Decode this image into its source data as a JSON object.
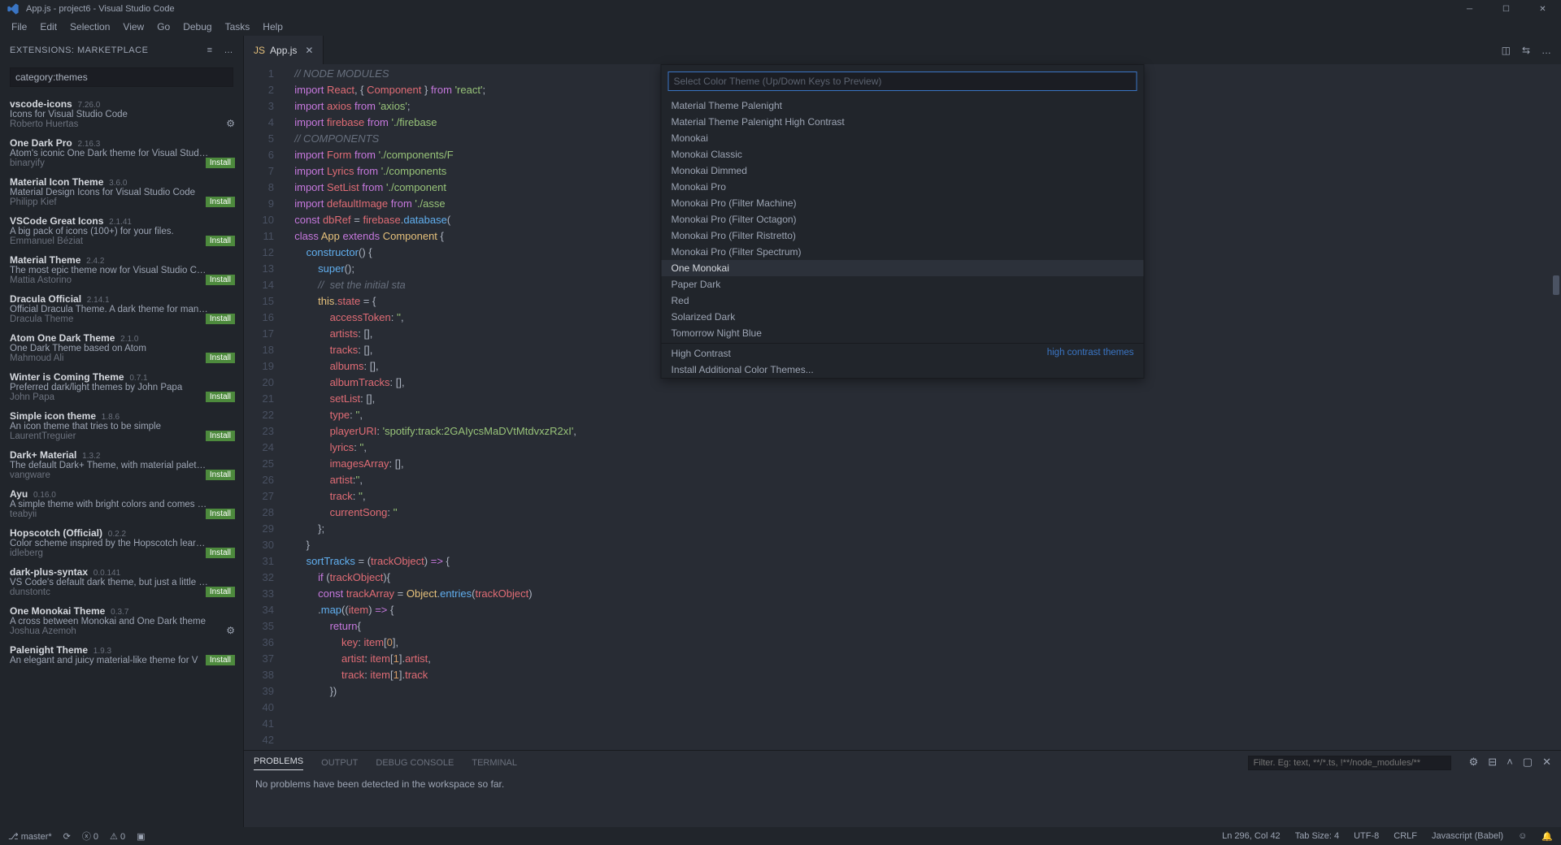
{
  "titlebar": {
    "title": "App.js - project6 - Visual Studio Code"
  },
  "menubar": [
    "File",
    "Edit",
    "Selection",
    "View",
    "Go",
    "Debug",
    "Tasks",
    "Help"
  ],
  "sidebar": {
    "title": "EXTENSIONS: MARKETPLACE",
    "search": "category:themes",
    "items": [
      {
        "name": "vscode-icons",
        "ver": "7.26.0",
        "desc": "Icons for Visual Studio Code",
        "auth": "Roberto Huertas",
        "installed": true
      },
      {
        "name": "One Dark Pro",
        "ver": "2.16.3",
        "desc": "Atom's iconic One Dark theme for Visual Stud…",
        "auth": "binaryify",
        "installed": false
      },
      {
        "name": "Material Icon Theme",
        "ver": "3.6.0",
        "desc": "Material Design Icons for Visual Studio Code",
        "auth": "Philipp Kief",
        "installed": false
      },
      {
        "name": "VSCode Great Icons",
        "ver": "2.1.41",
        "desc": "A big pack of icons (100+) for your files.",
        "auth": "Emmanuel Béziat",
        "installed": false
      },
      {
        "name": "Material Theme",
        "ver": "2.4.2",
        "desc": "The most epic theme now for Visual Studio C…",
        "auth": "Mattia Astorino",
        "installed": false
      },
      {
        "name": "Dracula Official",
        "ver": "2.14.1",
        "desc": "Official Dracula Theme. A dark theme for man…",
        "auth": "Dracula Theme",
        "installed": false
      },
      {
        "name": "Atom One Dark Theme",
        "ver": "2.1.0",
        "desc": "One Dark Theme based on Atom",
        "auth": "Mahmoud Ali",
        "installed": false
      },
      {
        "name": "Winter is Coming Theme",
        "ver": "0.7.1",
        "desc": "Preferred dark/light themes by John Papa",
        "auth": "John Papa",
        "installed": false
      },
      {
        "name": "Simple icon theme",
        "ver": "1.8.6",
        "desc": "An icon theme that tries to be simple",
        "auth": "LaurentTreguier",
        "installed": false
      },
      {
        "name": "Dark+ Material",
        "ver": "1.3.2",
        "desc": "The default Dark+ Theme, with material palet…",
        "auth": "vangware",
        "installed": false
      },
      {
        "name": "Ayu",
        "ver": "0.16.0",
        "desc": "A simple theme with bright colors and comes …",
        "auth": "teabyii",
        "installed": false
      },
      {
        "name": "Hopscotch (Official)",
        "ver": "0.2.2",
        "desc": "Color scheme inspired by the Hopscotch lear…",
        "auth": "idleberg",
        "installed": false
      },
      {
        "name": "dark-plus-syntax",
        "ver": "0.0.141",
        "desc": "VS Code's default dark theme, but just a little …",
        "auth": "dunstontc",
        "installed": false
      },
      {
        "name": "One Monokai Theme",
        "ver": "0.3.7",
        "desc": "A cross between Monokai and One Dark theme",
        "auth": "Joshua Azemoh",
        "installed": true
      },
      {
        "name": "Palenight Theme",
        "ver": "1.9.3",
        "desc": "An elegant and juicy material-like theme for V",
        "auth": "",
        "installed": false
      }
    ]
  },
  "tab": {
    "filename": "App.js"
  },
  "quickpick": {
    "placeholder": "Select Color Theme (Up/Down Keys to Preview)",
    "items": [
      "Material Theme Palenight",
      "Material Theme Palenight High Contrast",
      "Monokai",
      "Monokai Classic",
      "Monokai Dimmed",
      "Monokai Pro",
      "Monokai Pro (Filter Machine)",
      "Monokai Pro (Filter Octagon)",
      "Monokai Pro (Filter Ristretto)",
      "Monokai Pro (Filter Spectrum)",
      "One Monokai",
      "Paper Dark",
      "Red",
      "Solarized Dark",
      "Tomorrow Night Blue"
    ],
    "selectedIndex": 10,
    "highContrast": {
      "label": "High Contrast",
      "hint": "high contrast themes"
    },
    "install": "Install Additional Color Themes..."
  },
  "panel": {
    "tabs": [
      "PROBLEMS",
      "OUTPUT",
      "DEBUG CONSOLE",
      "TERMINAL"
    ],
    "filterPlaceholder": "Filter. Eg: text, **/*.ts, !**/node_modules/**",
    "message": "No problems have been detected in the workspace so far."
  },
  "statusbar": {
    "branch": "master*",
    "sync": "",
    "errors": "0",
    "warnings": "0",
    "position": "Ln 296, Col 42",
    "tabsize": "Tab Size: 4",
    "encoding": "UTF-8",
    "eol": "CRLF",
    "language": "Javascript (Babel)"
  },
  "code": {
    "startLine": 1,
    "lines": [
      {
        "t": "com",
        "s": "  // NODE MODULES"
      },
      {
        "t": "raw",
        "s": "  <k>import</k> <i>React</i>, { <i>Component</i> } <k>from</k> <s>'react'</s>;"
      },
      {
        "t": "raw",
        "s": "  <k>import</k> <i>axios</i> <k>from</k> <s>'axios'</s>;"
      },
      {
        "t": "raw",
        "s": "  <k>import</k> <i>firebase</i> <k>from</k> <s>'./firebase"
      },
      {
        "t": "raw",
        "s": ""
      },
      {
        "t": "com",
        "s": "  // COMPONENTS"
      },
      {
        "t": "raw",
        "s": "  <k>import</k> <i>Form</i> <k>from</k> <s>'./components/F"
      },
      {
        "t": "raw",
        "s": "  <k>import</k> <i>Lyrics</i> <k>from</k> <s>'./components"
      },
      {
        "t": "raw",
        "s": "  <k>import</k> <i>SetList</i> <k>from</k> <s>'./component"
      },
      {
        "t": "raw",
        "s": "  <k>import</k> <i>defaultImage</i> <k>from</k> <s>'./asse"
      },
      {
        "t": "raw",
        "s": ""
      },
      {
        "t": "raw",
        "s": "  <k>const</k> <i>dbRef</i> = <i>firebase</i>.<f>database</f>("
      },
      {
        "t": "raw",
        "s": ""
      },
      {
        "t": "raw",
        "s": "  <k>class</k> <c>App</c> <k>extends</k> <c>Component</c> {"
      },
      {
        "t": "raw",
        "s": "      <f>constructor</f>() {"
      },
      {
        "t": "raw",
        "s": "          <f>super</f>();"
      },
      {
        "t": "com",
        "s": "          //  set the initial sta"
      },
      {
        "t": "raw",
        "s": "          <th>this</th>.<i>state</i> = {"
      },
      {
        "t": "raw",
        "s": "              <i>accessToken</i>: <s>''</s>,"
      },
      {
        "t": "raw",
        "s": "              <i>artists</i>: [],"
      },
      {
        "t": "raw",
        "s": "              <i>tracks</i>: [],"
      },
      {
        "t": "raw",
        "s": "              <i>albums</i>: [],"
      },
      {
        "t": "raw",
        "s": "              <i>albumTracks</i>: [],"
      },
      {
        "t": "raw",
        "s": "              <i>setList</i>: [],"
      },
      {
        "t": "raw",
        "s": "              <i>type</i>: <s>''</s>,"
      },
      {
        "t": "raw",
        "s": "              <i>playerURI</i>: <s>'spotify:track:2GAIycsMaDVtMtdvxzR2xI'</s>,"
      },
      {
        "t": "raw",
        "s": "              <i>lyrics</i>: <s>''</s>,"
      },
      {
        "t": "raw",
        "s": "              <i>imagesArray</i>: [],"
      },
      {
        "t": "raw",
        "s": "              <i>artist</i>:<s>''</s>,"
      },
      {
        "t": "raw",
        "s": "              <i>track</i>: <s>''</s>,"
      },
      {
        "t": "raw",
        "s": "              <i>currentSong</i>: <s>''</s>"
      },
      {
        "t": "raw",
        "s": "          };"
      },
      {
        "t": "raw",
        "s": "      }"
      },
      {
        "t": "raw",
        "s": "      <f>sortTracks</f> = (<i>trackObject</i>) <k>=></k> {"
      },
      {
        "t": "raw",
        "s": "          <k>if</k> (<i>trackObject</i>){"
      },
      {
        "t": "raw",
        "s": "          <k>const</k> <i>trackArray</i> = <c>Object</c>.<f>entries</f>(<i>trackObject</i>)"
      },
      {
        "t": "raw",
        "s": "          .<f>map</f>((<i>item</i>) <k>=></k> {"
      },
      {
        "t": "raw",
        "s": "              <k>return</k>{"
      },
      {
        "t": "raw",
        "s": "                  <i>key</i>: <i>item</i>[<n>0</n>],"
      },
      {
        "t": "raw",
        "s": "                  <i>artist</i>: <i>item</i>[<n>1</n>].<i>artist</i>,"
      },
      {
        "t": "raw",
        "s": "                  <i>track</i>: <i>item</i>[<n>1</n>].<i>track</i>"
      },
      {
        "t": "raw",
        "s": "              })"
      }
    ]
  }
}
